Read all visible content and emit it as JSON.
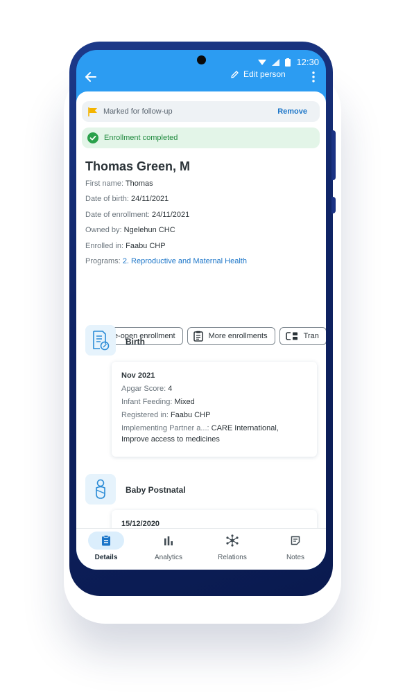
{
  "status_bar": {
    "time": "12:30"
  },
  "app_bar": {
    "edit_label": "Edit person"
  },
  "follow_up": {
    "text": "Marked for follow-up",
    "action": "Remove"
  },
  "enrollment_status": "Enrollment completed",
  "person": {
    "name": "Thomas Green, M",
    "attributes": [
      {
        "label": "First name:",
        "value": "Thomas"
      },
      {
        "label": "Date of birth:",
        "value": "24/11/2021"
      },
      {
        "label": "Date of enrollment:",
        "value": "24/11/2021"
      },
      {
        "label": "Owned by:",
        "value": "Ngelehun CHC"
      },
      {
        "label": "Enrolled in:",
        "value": "Faabu CHP"
      },
      {
        "label": "Programs:",
        "value": "2. Reproductive and Maternal Health"
      }
    ]
  },
  "actions": {
    "reopen": "Re-open enrollment",
    "more": "More enrollments",
    "transfer": "Tran"
  },
  "events": [
    {
      "title": "Birth",
      "icon": "document-edit-icon",
      "date": "Nov 2021",
      "rows": [
        {
          "label": "Apgar Score:",
          "value": "4"
        },
        {
          "label": "Infant Feeding:",
          "value": "Mixed"
        },
        {
          "label": "Registered in:",
          "value": "Faabu CHP"
        },
        {
          "label": "Implementing Partner a...:",
          "value": "CARE International, Improve access to medicines"
        }
      ]
    },
    {
      "title": "Baby Postnatal",
      "icon": "baby-icon",
      "date": "15/12/2020"
    }
  ],
  "bottom_nav": {
    "details": "Details",
    "analytics": "Analytics",
    "relations": "Relations",
    "notes": "Notes"
  },
  "colors": {
    "primary": "#2c9cf2",
    "link": "#1b75c8",
    "success": "#1f8a3e",
    "flag": "#f4b400",
    "reopen_icon": "#f07a1e"
  }
}
